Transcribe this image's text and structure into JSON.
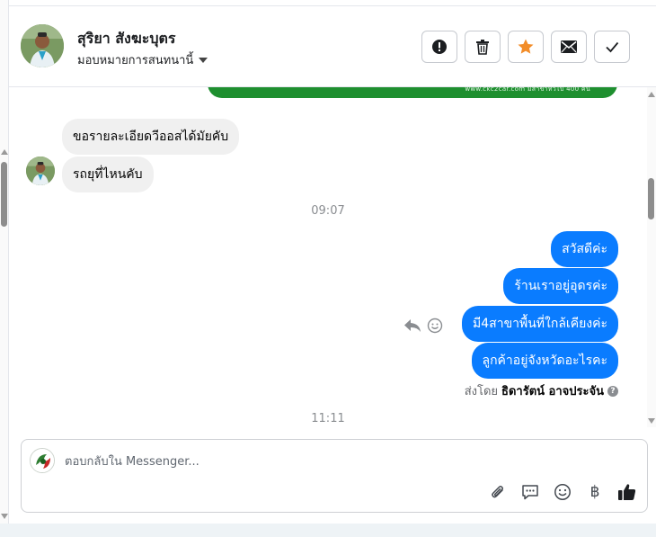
{
  "header": {
    "contact_name": "สุริยา สังฆะบุตร",
    "assign_label": "มอบหมายการสนทนานี้",
    "actions": [
      {
        "name": "report-spam-button",
        "icon": "exclamation-circle-icon"
      },
      {
        "name": "delete-button",
        "icon": "trash-icon"
      },
      {
        "name": "star-button",
        "icon": "star-icon",
        "color": "#f28c28"
      },
      {
        "name": "mark-unread-button",
        "icon": "envelope-icon"
      },
      {
        "name": "mark-done-button",
        "icon": "check-icon"
      }
    ]
  },
  "banner": {
    "text": "www.ckc2car.com  มีสาขาทั่วไป 400 คัน"
  },
  "messages_in": [
    {
      "text": "ขอรายละเอียดวีออสได้มัยคับ"
    },
    {
      "text": "รถยุที่ไหนคับ"
    }
  ],
  "time_1": "09:07",
  "messages_out": [
    {
      "text": "สวัสดีค่ะ"
    },
    {
      "text": "ร้านเราอยู่อุดรค่ะ"
    },
    {
      "text": "มี4สาขาพื้นที่ใกล้เคียงค่ะ"
    },
    {
      "text": "ลูกค้าอยู่จังหวัดอะไรคะ"
    }
  ],
  "sent_by": {
    "prefix": "ส่งโดย",
    "name": "ธิดารัตน์ อาจประจัน",
    "help": "?"
  },
  "time_2": "11:11",
  "composer": {
    "placeholder": "ตอบกลับใน Messenger...",
    "tools": [
      "paperclip-icon",
      "saved-reply-icon",
      "emoji-icon",
      "baht-icon",
      "thumbs-up-icon"
    ],
    "baht_symbol": "฿"
  },
  "colors": {
    "accent": "#0a7cff",
    "banner_green": "#1e8f2f",
    "star": "#f28c28"
  }
}
